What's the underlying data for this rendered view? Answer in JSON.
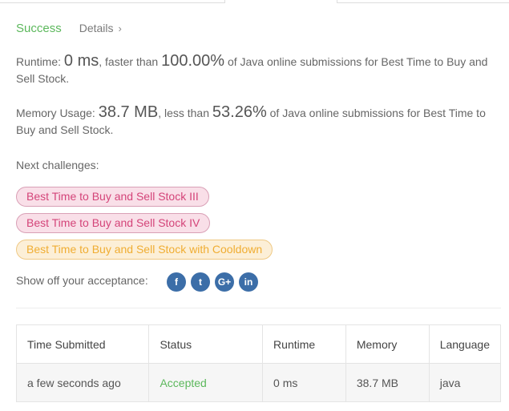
{
  "result": {
    "status": "Success",
    "details_label": "Details",
    "chevron": "›"
  },
  "runtime": {
    "prefix": "Runtime: ",
    "value": "0 ms",
    "mid": ", faster than ",
    "percent": "100.00%",
    "suffix": " of Java online submissions for Best Time to Buy and Sell Stock."
  },
  "memory": {
    "prefix": "Memory Usage: ",
    "value": "38.7 MB",
    "mid": ", less than ",
    "percent": "53.26%",
    "suffix": " of Java online submissions for Best Time to Buy and Sell Stock."
  },
  "challenges": {
    "label": "Next challenges:",
    "items": [
      {
        "label": "Best Time to Buy and Sell Stock III",
        "difficulty": "hard"
      },
      {
        "label": "Best Time to Buy and Sell Stock IV",
        "difficulty": "hard"
      },
      {
        "label": "Best Time to Buy and Sell Stock with Cooldown",
        "difficulty": "medium"
      }
    ]
  },
  "share": {
    "label": "Show off your acceptance:",
    "icons": [
      {
        "name": "facebook-icon",
        "glyph": "f"
      },
      {
        "name": "twitter-icon",
        "glyph": "t"
      },
      {
        "name": "google-plus-icon",
        "glyph": "G+"
      },
      {
        "name": "linkedin-icon",
        "glyph": "in"
      }
    ]
  },
  "table": {
    "headers": [
      "Time Submitted",
      "Status",
      "Runtime",
      "Memory",
      "Language"
    ],
    "rows": [
      [
        "a few seconds ago",
        "Accepted",
        "0 ms",
        "38.7 MB",
        "java"
      ]
    ]
  },
  "colors": {
    "success": "#5cb85c",
    "hard": "#d44479",
    "medium": "#f0ad32",
    "share_button": "#3c6ea8"
  }
}
